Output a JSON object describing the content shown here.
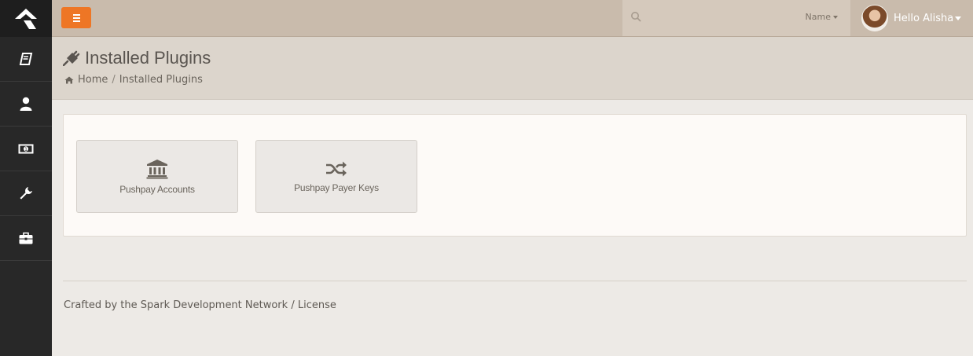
{
  "sidebar": {
    "items": [
      {
        "icon": "book-icon"
      },
      {
        "icon": "user-icon"
      },
      {
        "icon": "money-icon"
      },
      {
        "icon": "wrench-icon"
      },
      {
        "icon": "briefcase-icon"
      }
    ]
  },
  "topbar": {
    "search_filter_label": "Name",
    "greeting": "Hello Alisha"
  },
  "page": {
    "title": "Installed Plugins",
    "breadcrumb": {
      "home": "Home",
      "separator": "/",
      "current": "Installed Plugins"
    }
  },
  "tiles": [
    {
      "label": "Pushpay Accounts",
      "icon": "bank-icon"
    },
    {
      "label": "Pushpay Payer Keys",
      "icon": "shuffle-icon"
    }
  ],
  "footer": {
    "prefix": "Crafted by the",
    "org": "Spark Development Network",
    "separator": "/",
    "license": "License"
  },
  "colors": {
    "accent": "#ee7625",
    "sidebar": "#282828",
    "topbar": "#c9bbac"
  }
}
